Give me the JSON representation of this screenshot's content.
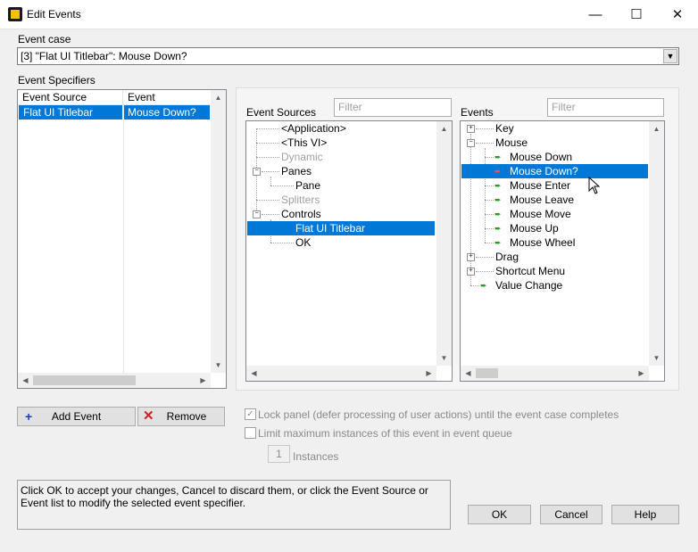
{
  "window": {
    "title": "Edit Events",
    "minimize": "—",
    "maximize": "☐",
    "close": "✕"
  },
  "event_case": {
    "label": "Event case",
    "value": "[3] \"Flat UI Titlebar\": Mouse Down?"
  },
  "specifiers": {
    "label": "Event Specifiers",
    "col_source": "Event Source",
    "col_event": "Event",
    "rows": [
      {
        "source": "Flat UI Titlebar",
        "event": "Mouse Down?"
      }
    ]
  },
  "event_sources": {
    "label": "Event Sources",
    "filter_placeholder": "Filter",
    "items": [
      {
        "label": "<Application>",
        "state": "normal"
      },
      {
        "label": "<This VI>",
        "state": "normal"
      },
      {
        "label": "Dynamic",
        "state": "disabled"
      },
      {
        "label": "Panes",
        "state": "expanded"
      },
      {
        "label": "Pane",
        "state": "child"
      },
      {
        "label": "Splitters",
        "state": "disabled"
      },
      {
        "label": "Controls",
        "state": "expanded"
      },
      {
        "label": "Flat UI Titlebar",
        "state": "selected"
      },
      {
        "label": "OK",
        "state": "child"
      }
    ]
  },
  "events": {
    "label": "Events",
    "filter_placeholder": "Filter",
    "items": [
      {
        "label": "Key"
      },
      {
        "label": "Mouse"
      },
      {
        "label": "Mouse Down"
      },
      {
        "label": "Mouse Down?"
      },
      {
        "label": "Mouse Enter"
      },
      {
        "label": "Mouse Leave"
      },
      {
        "label": "Mouse Move"
      },
      {
        "label": "Mouse Up"
      },
      {
        "label": "Mouse Wheel"
      },
      {
        "label": "Drag"
      },
      {
        "label": "Shortcut Menu"
      },
      {
        "label": "Value Change"
      }
    ]
  },
  "buttons": {
    "add_event": "Add Event",
    "remove": "Remove",
    "ok": "OK",
    "cancel": "Cancel",
    "help": "Help"
  },
  "options": {
    "lock_panel": "Lock panel (defer processing of user actions) until the event case completes",
    "limit_instances": "Limit maximum instances of this event in event queue",
    "instances_value": "1",
    "instances_label": "Instances"
  },
  "help_text": "Click OK to accept your changes, Cancel to discard them, or click the Event Source or Event list to modify the selected event specifier.",
  "colors": {
    "selection": "#0078d7",
    "add_icon": "#1a3fb0",
    "remove_icon": "#d21f1f",
    "notify_arrow": "#2e9d2e",
    "filter_arrow": "#d21f1f"
  }
}
